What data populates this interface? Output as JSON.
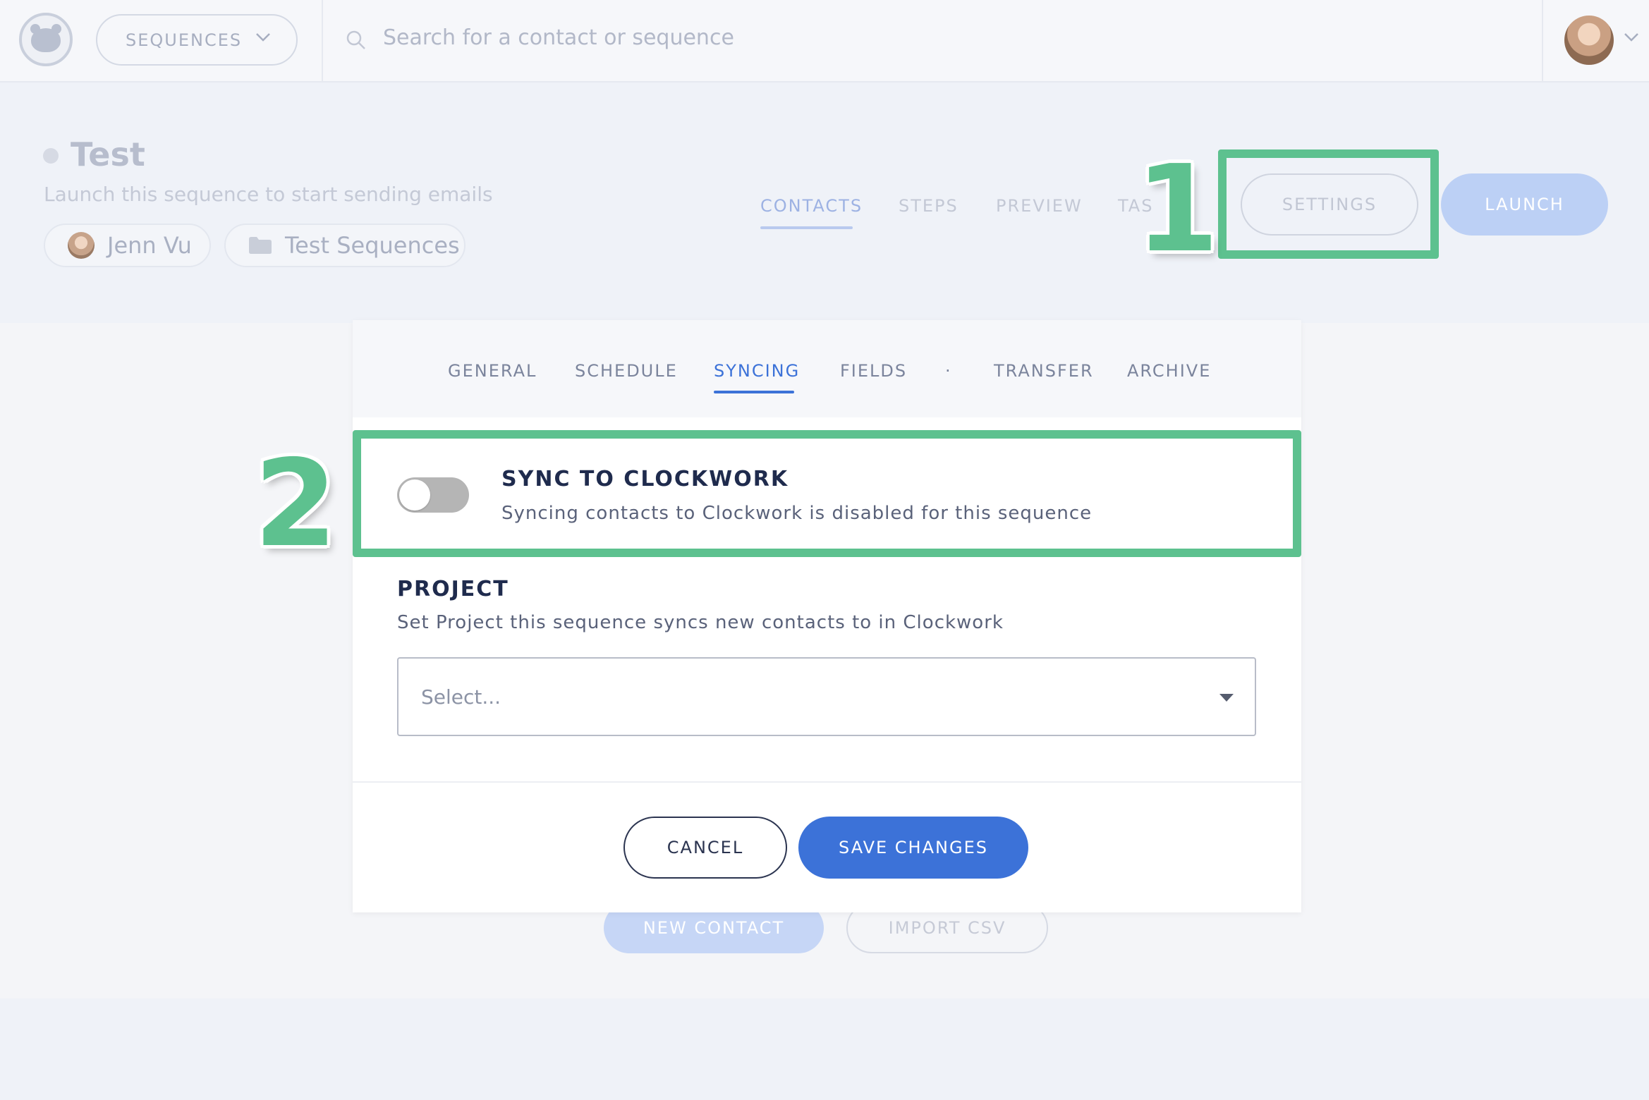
{
  "topbar": {
    "nav_dropdown_label": "SEQUENCES",
    "search_placeholder": "Search for a contact or sequence"
  },
  "sequence": {
    "title": "Test",
    "subtitle": "Launch this sequence to start sending emails",
    "owner": "Jenn Vu",
    "folder": "Test Sequences"
  },
  "header_tabs": [
    "CONTACTS",
    "STEPS",
    "PREVIEW",
    "TAS"
  ],
  "header_actions": {
    "settings": "SETTINGS",
    "launch": "LAUNCH"
  },
  "annotations": {
    "step1": "1",
    "step2": "2",
    "highlight_color": "#5dc18f"
  },
  "background_actions": {
    "new_contact": "NEW CONTACT",
    "import_csv": "IMPORT CSV"
  },
  "modal": {
    "tabs": [
      "GENERAL",
      "SCHEDULE",
      "SYNCING",
      "FIELDS",
      "·",
      "TRANSFER",
      "ARCHIVE"
    ],
    "active_tab": "SYNCING",
    "sync": {
      "title": "SYNC TO CLOCKWORK",
      "description": "Syncing contacts to Clockwork is disabled for this sequence",
      "enabled": false
    },
    "project": {
      "title": "PROJECT",
      "description": "Set Project this sequence syncs new contacts to in Clockwork",
      "placeholder": "Select..."
    },
    "cancel": "CANCEL",
    "save": "SAVE CHANGES"
  },
  "colors": {
    "primary": "#3c72d8",
    "highlight": "#5dc18f"
  }
}
